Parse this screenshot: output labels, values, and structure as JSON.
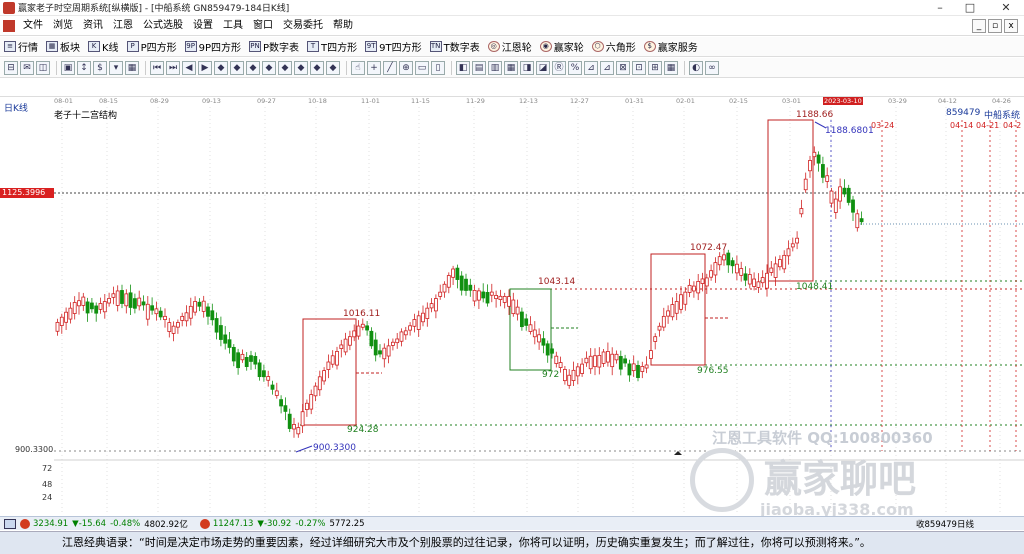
{
  "window": {
    "title": "赢家老子时空周期系统[纵横版] - [中船系统  GN859479-184日K线]",
    "minimize": "–",
    "maximize": "□",
    "close": "✕"
  },
  "menu": [
    "文件",
    "浏览",
    "资讯",
    "江恩",
    "公式选股",
    "设置",
    "工具",
    "窗口",
    "交易委托",
    "帮助"
  ],
  "toolbar1": [
    {
      "icon": "quote-icon",
      "label": "行情"
    },
    {
      "icon": "sector-icon",
      "label": "板块"
    },
    {
      "icon": "kline-icon",
      "label": "K线"
    },
    {
      "icon": "p-square-icon",
      "label": "P四方形"
    },
    {
      "icon": "p9-square-icon",
      "label": "9P四方形"
    },
    {
      "icon": "pn-square-icon",
      "label": "P数字表"
    },
    {
      "icon": "t-square-icon",
      "label": "T四方形"
    },
    {
      "icon": "t9-square-icon",
      "label": "9T四方形"
    },
    {
      "icon": "tn-square-icon",
      "label": "T数字表"
    },
    {
      "icon": "gann-wheel-icon",
      "label": "江恩轮"
    },
    {
      "icon": "winner-wheel-icon",
      "label": "赢家轮"
    },
    {
      "icon": "hexagon-icon",
      "label": "六角形"
    },
    {
      "icon": "service-icon",
      "label": "赢家服务"
    }
  ],
  "toolbar2_icons": [
    "⊟",
    "✉",
    "◫",
    "▣",
    "↕",
    "$",
    "▾",
    "▦",
    "⏮",
    "⏭",
    "◀",
    "▶",
    "◆",
    "◆",
    "◆",
    "◆",
    "◆",
    "◆",
    "◆",
    "◆",
    "☝",
    "+",
    "╱",
    "⊕",
    "▭",
    "▯",
    "◧",
    "▤",
    "▥",
    "▦",
    "◨",
    "◪",
    "Ⓡ",
    "%",
    "⊿",
    "⊿",
    "⊠",
    "⊡",
    "⊞",
    "▦",
    "◐",
    "∞"
  ],
  "dates": [
    "08-01",
    "08-15",
    "08-29",
    "09-13",
    "09-27",
    "10-18",
    "11-01",
    "11-15",
    "11-29",
    "12-13",
    "12-27",
    "01-31",
    "02-01",
    "02-15",
    "03-01",
    "2023-03-10",
    "03-29",
    "04-12",
    "04-26"
  ],
  "chart": {
    "period": "日K线",
    "indicator_title": "老子十二宫结构",
    "current_price": "1125.3996",
    "left_low_price": "900.3300",
    "y_ticks": [
      "72",
      "48",
      "24"
    ],
    "code": "859479",
    "name": "中船系统",
    "future_dates": [
      "04-14",
      "04-21",
      "04-2"
    ],
    "label_0324": "03-24",
    "annotations": {
      "low": "900.3300",
      "box1_high": "1016.11",
      "box1_low": "924.28",
      "box2_high": "1043.14",
      "box2_low": "972",
      "box3_high": "1072.47",
      "box3_low": "976.55",
      "box4_high": "1188.66",
      "box4_low": "1048.41",
      "peak": "1188.6801"
    },
    "watermark1": "江恩工具软件  QQ:100800360",
    "watermark2": "赢家聊吧",
    "watermark3": "jiaoba.yj338.com"
  },
  "status": {
    "sh": "3234.91",
    "sh_chg": "▼-15.64",
    "sh_pct": "-0.48%",
    "sh_vol": "4802.92亿",
    "sz": "11247.13",
    "sz_chg": "▼-30.92",
    "sz_pct": "-0.27%",
    "sz_vol": "5772.25",
    "right": "收859479日线"
  },
  "quote": "江恩经典语录：“时间是决定市场走势的重要因素，经过详细研究大市及个别股票的过往记录，你将可以证明，历史确实重复发生；而了解过往，你将可以预测将来。”。"
}
